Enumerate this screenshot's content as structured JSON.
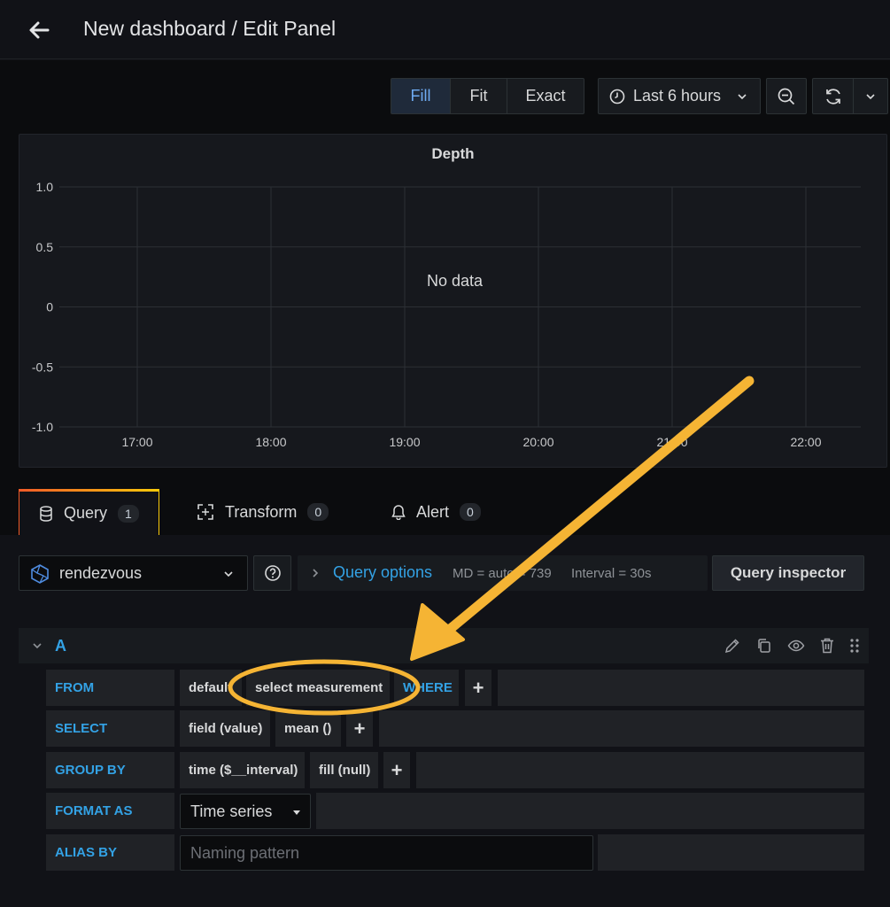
{
  "header": {
    "title": "New dashboard / Edit Panel"
  },
  "toolbar": {
    "fill_label": "Fill",
    "fit_label": "Fit",
    "exact_label": "Exact",
    "time_range": "Last 6 hours"
  },
  "chart_data": {
    "type": "line",
    "title": "Depth",
    "message": "No data",
    "y_ticks": [
      "1.0",
      "0.5",
      "0",
      "-0.5",
      "-1.0"
    ],
    "x_ticks": [
      "17:00",
      "18:00",
      "19:00",
      "20:00",
      "21:00",
      "22:00"
    ],
    "ylim": [
      -1.0,
      1.0
    ],
    "grid": true,
    "series": []
  },
  "tabs": [
    {
      "label": "Query",
      "count": "1"
    },
    {
      "label": "Transform",
      "count": "0"
    },
    {
      "label": "Alert",
      "count": "0"
    }
  ],
  "datasource": {
    "name": "rendezvous"
  },
  "query_options": {
    "label": "Query options",
    "md": "MD = auto = 739",
    "interval": "Interval = 30s"
  },
  "query_inspector_label": "Query inspector",
  "query": {
    "ref": "A",
    "from": {
      "label": "FROM",
      "policy": "default",
      "measurement": "select measurement",
      "where": "WHERE"
    },
    "select": {
      "label": "SELECT",
      "field": "field (value)",
      "agg": "mean ()"
    },
    "group_by": {
      "label": "GROUP BY",
      "time": "time ($__interval)",
      "fill": "fill (null)"
    },
    "format_as": {
      "label": "FORMAT AS",
      "value": "Time series"
    },
    "alias_by": {
      "label": "ALIAS BY",
      "placeholder": "Naming pattern"
    }
  },
  "colors": {
    "accent": "#33a2e5",
    "annotation": "#f5b434",
    "background": "#111217"
  }
}
